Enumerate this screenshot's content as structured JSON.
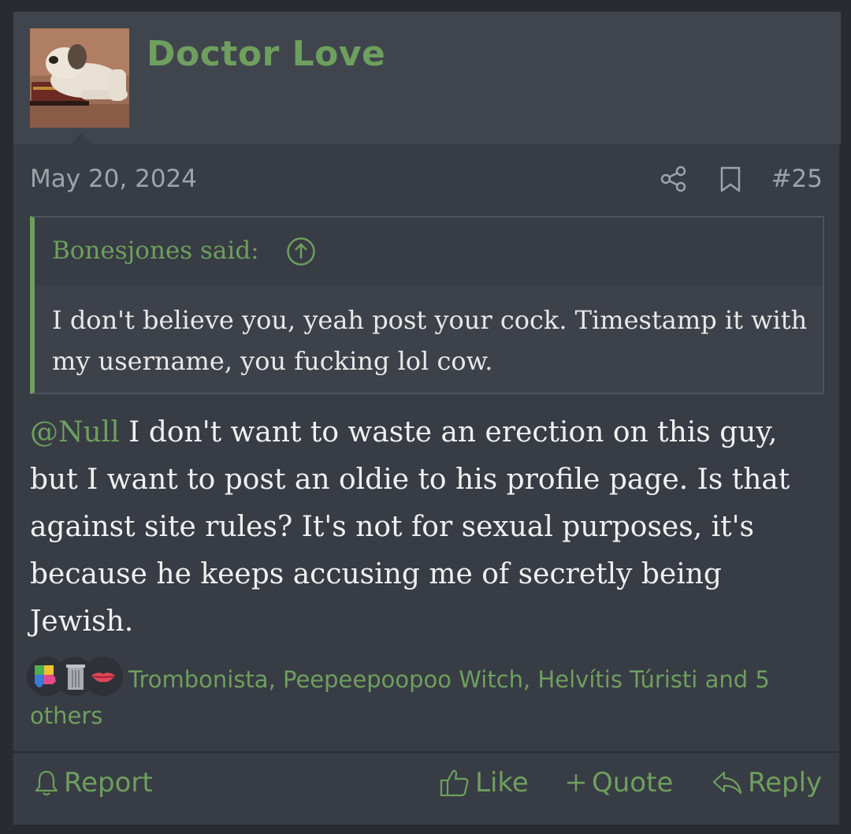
{
  "post": {
    "author": "Doctor Love",
    "date": "May 20, 2024",
    "post_number": "#25",
    "icons": {
      "share": "share-icon",
      "bookmark": "bookmark-icon"
    }
  },
  "quote": {
    "author_label": "Bonesjones said:",
    "icon": "arrow-up-circle-icon",
    "text": "I don't believe you, yeah post your cock. Timestamp it with my username, you fucking lol cow."
  },
  "message": {
    "mention": "@Null",
    "text": " I don't want to waste an erection on this guy, but I want to post an oldie to his profile page. Is that against site rules? It's not for sexual purposes, it's because he keeps accusing me of secretly being Jewish."
  },
  "reactions": {
    "icons": [
      "puzzle-icon",
      "trash-can-icon",
      "lips-icon"
    ],
    "summary": "Trombonista, Peepeepoopoo Witch, Helvítis Túristi and 5 others"
  },
  "footer": {
    "report_label": "Report",
    "like_label": "Like",
    "quote_label": "Quote",
    "reply_label": "Reply"
  },
  "colors": {
    "accent": "#6e9f5e",
    "background": "#383c44",
    "header": "#40454d",
    "muted_text": "#9ea3aa"
  }
}
